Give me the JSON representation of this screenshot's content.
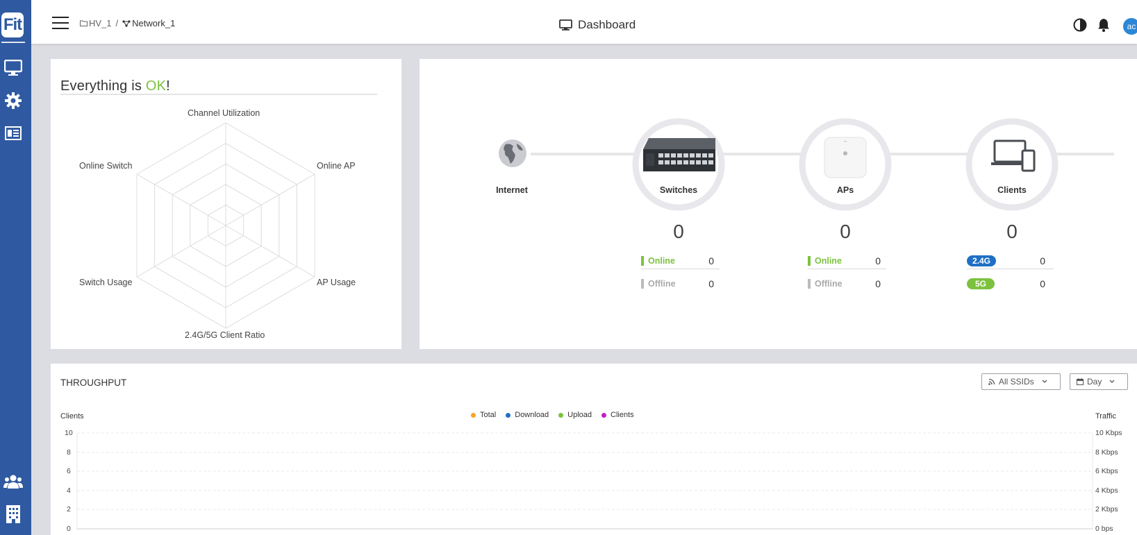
{
  "app": {
    "logo_text": "Fit"
  },
  "breadcrumb": {
    "parent": "HV_1",
    "separator": "/",
    "current": "Network_1"
  },
  "header": {
    "title": "Dashboard",
    "avatar_initials": "ac"
  },
  "sidebar": {
    "items": [
      {
        "icon": "monitor-icon"
      },
      {
        "icon": "gear-icon"
      },
      {
        "icon": "report-icon"
      },
      {
        "icon": "users-icon"
      },
      {
        "icon": "building-icon"
      }
    ]
  },
  "health": {
    "title_prefix": "Everything is ",
    "title_ok": "OK",
    "title_suffix": "!",
    "ok_color": "#7cc23f",
    "radar_axes": [
      "Channel Utilization",
      "Online AP",
      "AP Usage",
      "2.4G/5G Client Ratio",
      "Switch Usage",
      "Online Switch"
    ]
  },
  "topology": {
    "internet": {
      "label": "Internet"
    },
    "switches": {
      "label": "Switches",
      "total": "0",
      "online_label": "Online",
      "online": "0",
      "offline_label": "Offline",
      "offline": "0"
    },
    "aps": {
      "label": "APs",
      "total": "0",
      "online_label": "Online",
      "online": "0",
      "offline_label": "Offline",
      "offline": "0"
    },
    "clients": {
      "label": "Clients",
      "total": "0",
      "band1_label": "2.4G",
      "band1": "0",
      "band2_label": "5G",
      "band2": "0"
    },
    "colors": {
      "online": "#7cc23f",
      "offline": "#bbbbbb",
      "band1": "#1f6fc5",
      "band2": "#7cc23f"
    }
  },
  "throughput": {
    "title": "THROUGHPUT",
    "ssid_dropdown": "All SSIDs",
    "period_dropdown": "Day",
    "left_axis_title": "Clients",
    "right_axis_title": "Traffic",
    "left_ticks": [
      "10",
      "8",
      "6",
      "4",
      "2",
      "0"
    ],
    "right_ticks": [
      "10 Kbps",
      "8 Kbps",
      "6 Kbps",
      "4 Kbps",
      "2 Kbps",
      "0 bps"
    ],
    "legend": [
      {
        "label": "Total",
        "color": "#f5a623"
      },
      {
        "label": "Download",
        "color": "#1f6fc5"
      },
      {
        "label": "Upload",
        "color": "#7cc23f"
      },
      {
        "label": "Clients",
        "color": "#c21fc9"
      }
    ]
  }
}
